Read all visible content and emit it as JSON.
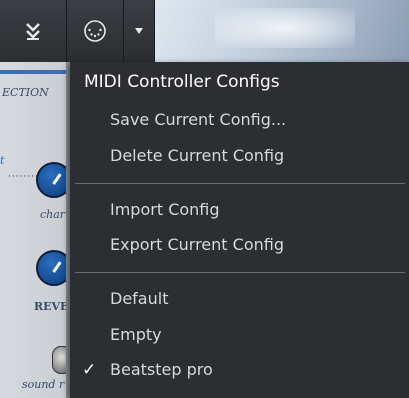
{
  "toolbar": {
    "icons": [
      "double-chevron-down-icon",
      "midi-connector-icon",
      "caret-down-icon"
    ]
  },
  "panel": {
    "section_label": "ECTION",
    "knob1_label": "char",
    "knob2_label": "REVE",
    "switch_label": "sound r",
    "left_fragment": "t"
  },
  "menu": {
    "title": "MIDI Controller Configs",
    "group1": [
      {
        "label": "Save Current Config..."
      },
      {
        "label": "Delete Current Config"
      }
    ],
    "group2": [
      {
        "label": "Import Config"
      },
      {
        "label": "Export Current Config"
      }
    ],
    "configs": [
      {
        "label": "Default",
        "checked": false
      },
      {
        "label": "Empty",
        "checked": false
      },
      {
        "label": "Beatstep pro",
        "checked": true
      }
    ],
    "check_glyph": "✓"
  }
}
